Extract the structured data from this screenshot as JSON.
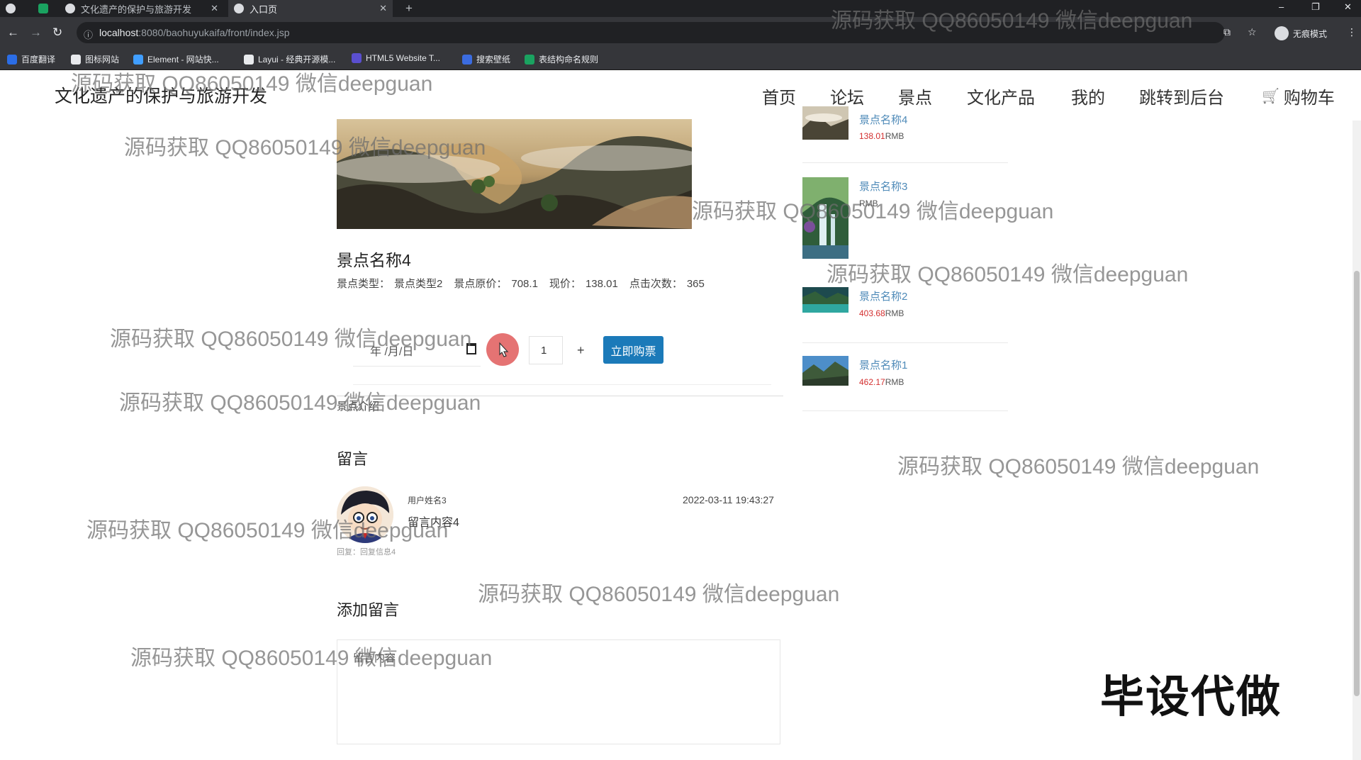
{
  "browser": {
    "tabs": [
      {
        "label": ""
      },
      {
        "label": "文化遗产的保护与旅游开发"
      },
      {
        "label": "入口页"
      }
    ],
    "new_tab": "+",
    "window_controls": {
      "minimize": "–",
      "restore": "❐",
      "close": "✕"
    },
    "nav": {
      "back": "←",
      "forward": "→",
      "reload": "↻"
    },
    "url_host": "localhost",
    "url_path": ":8080/baohuyukaifa/front/index.jsp",
    "translate_icon": "⧉",
    "star_icon": "☆",
    "incognito_label": "无痕模式",
    "menu_icon": "⋮",
    "bookmarks": [
      {
        "label": "百度翻译",
        "color": "#2b6de6"
      },
      {
        "label": "图标网站",
        "color": "#e8eaed"
      },
      {
        "label": "Element - 网站快...",
        "color": "#409eff"
      },
      {
        "label": "Layui - 经典开源模...",
        "color": "#e8eaed"
      },
      {
        "label": "HTML5 Website T...",
        "color": "#5a4fcf"
      },
      {
        "label": "搜索壁纸",
        "color": "#3b6ce0"
      },
      {
        "label": "表结构命名规则",
        "color": "#1aa260"
      }
    ]
  },
  "header": {
    "site_title": "文化遗产的保护与旅游开发",
    "nav": [
      "首页",
      "论坛",
      "景点",
      "文化产品",
      "我的",
      "跳转到后台"
    ],
    "cart_icon": "🛒",
    "cart": "购物车"
  },
  "spot": {
    "title": "景点名称4",
    "type_label": "景点类型：",
    "type_value": "景点类型2",
    "orig_label": "景点原价：",
    "orig_value": "708.1",
    "now_label": "现价：",
    "now_value": "138.01",
    "clicks_label": "点击次数：",
    "clicks_value": "365"
  },
  "purchase": {
    "date_placeholder": "年 /月/日",
    "quantity": "1",
    "plus": "+",
    "buy_button": "立即购票"
  },
  "intro_label": "景点介绍",
  "messages": {
    "heading": "留言",
    "items": [
      {
        "user": "用户姓名3",
        "time": "2022-03-11 19:43:27",
        "content": "留言内容4",
        "reply": "回复：回复信息4"
      }
    ]
  },
  "add_message": {
    "heading": "添加留言",
    "placeholder": "留言内容"
  },
  "sidebar": {
    "items": [
      {
        "name": "景点名称4",
        "price": "138.01",
        "unit": "RMB"
      },
      {
        "name": "景点名称3",
        "price": "",
        "unit": "RMB"
      },
      {
        "name": "景点名称2",
        "price": "403.68",
        "unit": "RMB"
      },
      {
        "name": "景点名称1",
        "price": "462.17",
        "unit": "RMB"
      }
    ]
  },
  "watermark_text": "源码获取 QQ86050149 微信deepguan",
  "stamp": "毕设代做"
}
